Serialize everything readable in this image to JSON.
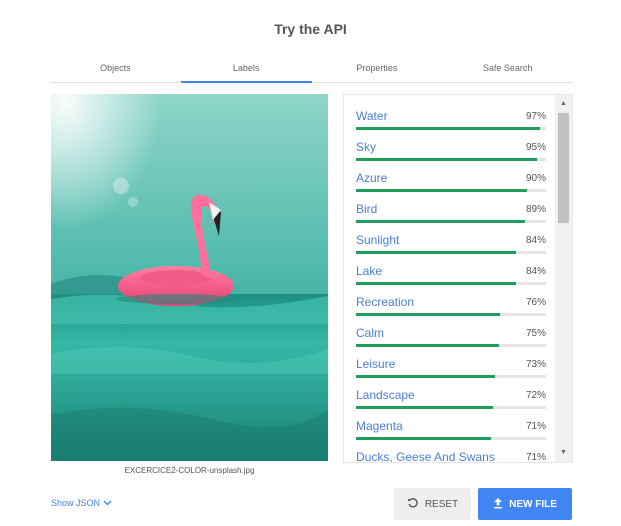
{
  "title": "Try the API",
  "tabs": [
    {
      "label": "Objects"
    },
    {
      "label": "Labels"
    },
    {
      "label": "Properties"
    },
    {
      "label": "Safe Search"
    }
  ],
  "active_tab": "Labels",
  "image": {
    "filename": "EXCERCICE2-COLOR-unsplash.jpg"
  },
  "labels": [
    {
      "name": "Water",
      "percent": "97%",
      "score": 0.97
    },
    {
      "name": "Sky",
      "percent": "95%",
      "score": 0.95
    },
    {
      "name": "Azure",
      "percent": "90%",
      "score": 0.9
    },
    {
      "name": "Bird",
      "percent": "89%",
      "score": 0.89
    },
    {
      "name": "Sunlight",
      "percent": "84%",
      "score": 0.84
    },
    {
      "name": "Lake",
      "percent": "84%",
      "score": 0.84
    },
    {
      "name": "Recreation",
      "percent": "76%",
      "score": 0.76
    },
    {
      "name": "Calm",
      "percent": "75%",
      "score": 0.75
    },
    {
      "name": "Leisure",
      "percent": "73%",
      "score": 0.73
    },
    {
      "name": "Landscape",
      "percent": "72%",
      "score": 0.72
    },
    {
      "name": "Magenta",
      "percent": "71%",
      "score": 0.71
    },
    {
      "name": "Ducks, Geese And Swans",
      "percent": "71%",
      "score": 0.71
    }
  ],
  "footer": {
    "show_json_label": "Show JSON",
    "reset_label": "RESET",
    "new_file_label": "NEW FILE"
  },
  "colors": {
    "accent": "#4285f4",
    "bar": "#1e9e5a"
  }
}
